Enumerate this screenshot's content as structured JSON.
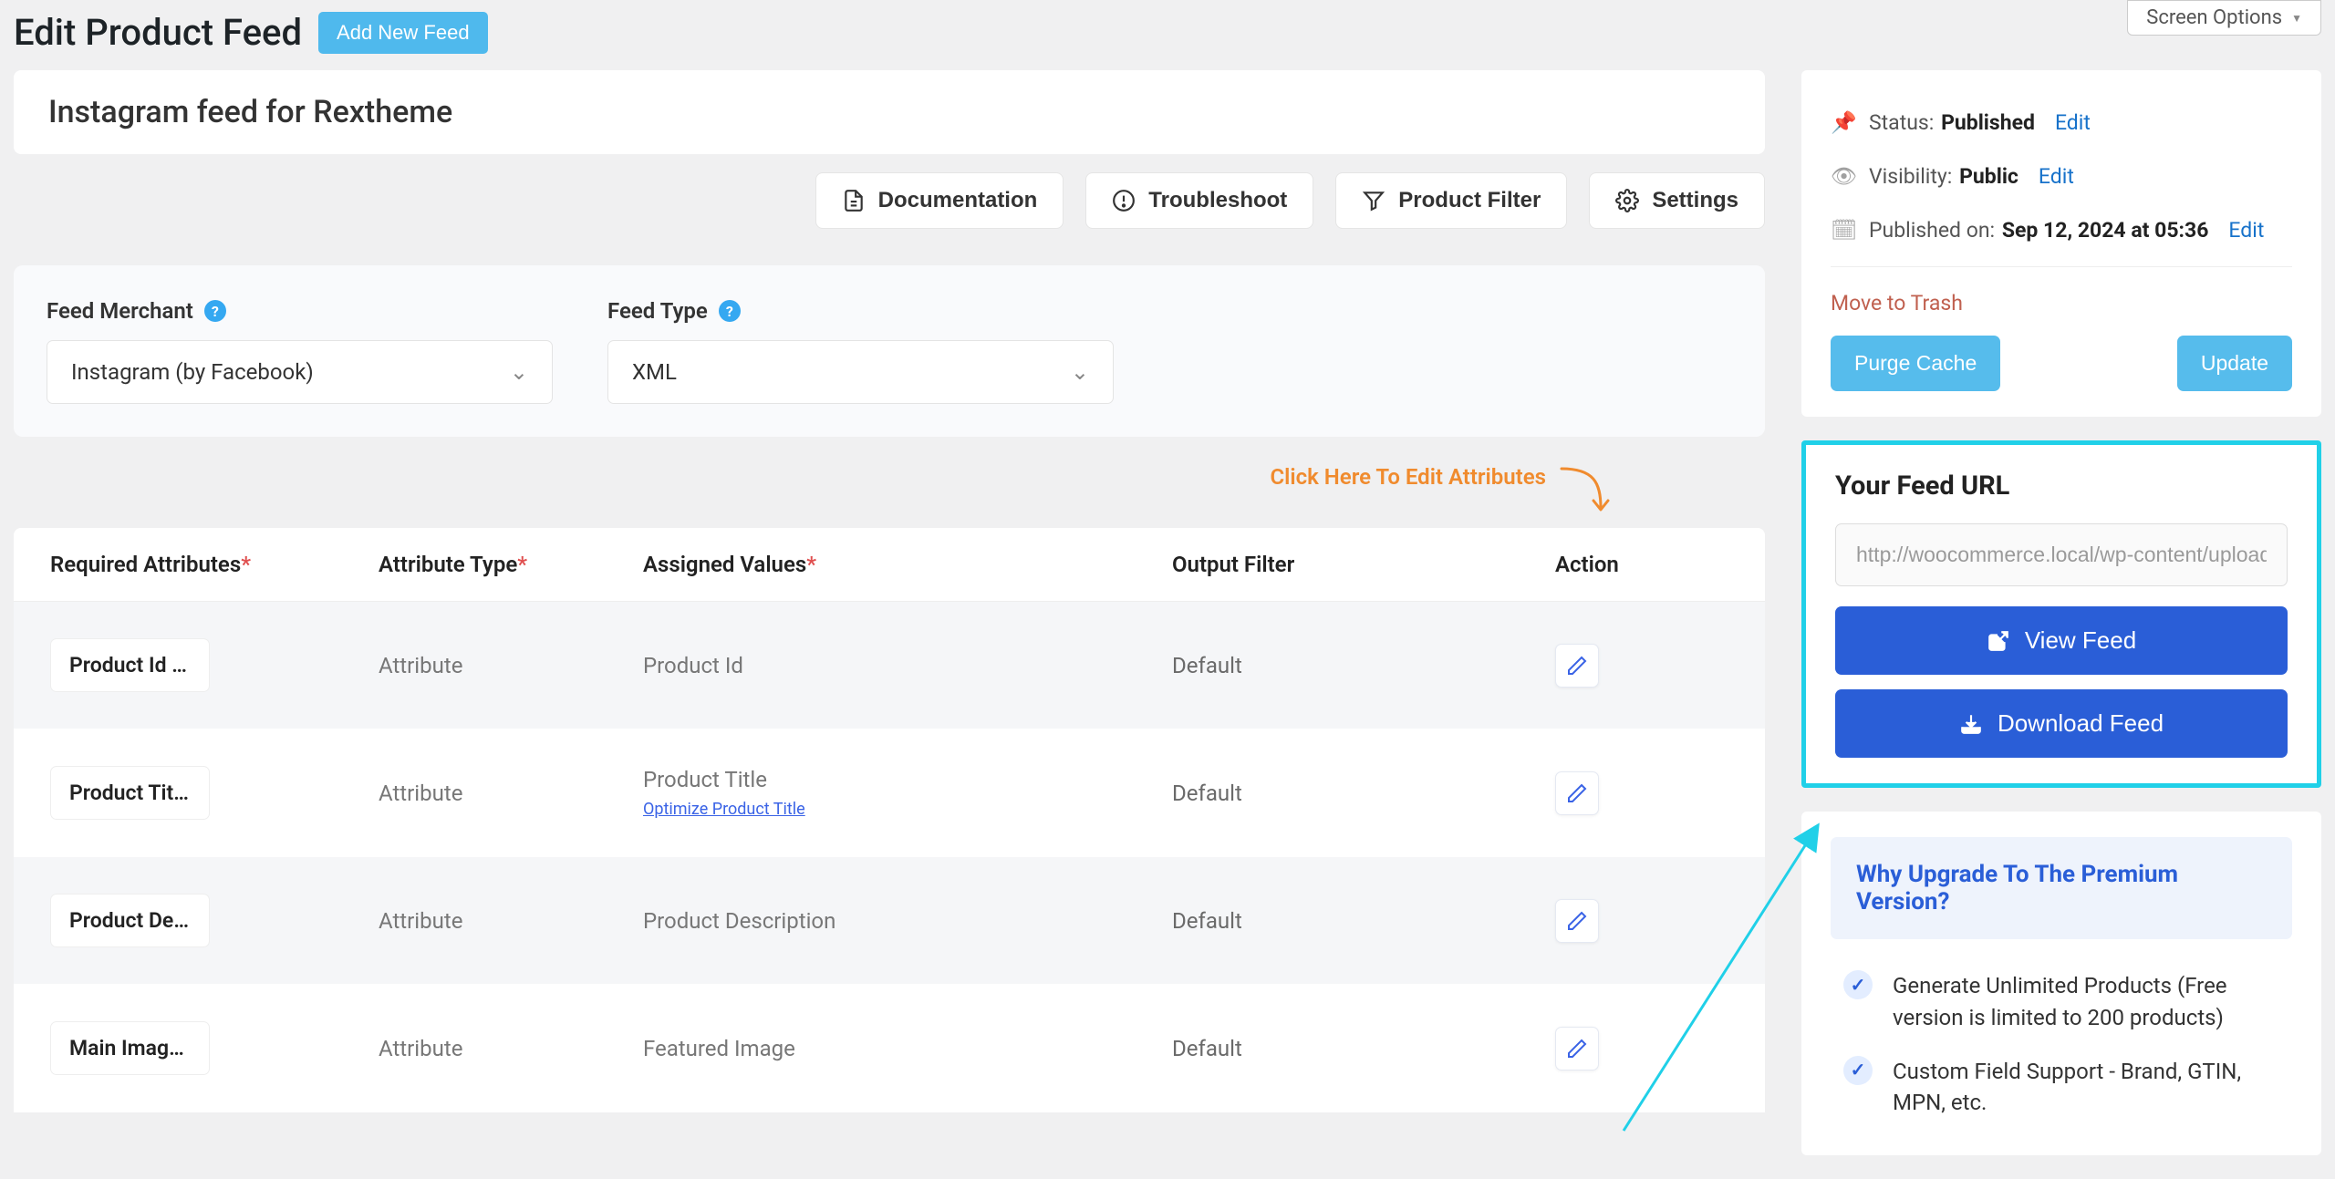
{
  "header": {
    "title": "Edit Product Feed",
    "add_new": "Add New Feed",
    "screen_options": "Screen Options"
  },
  "feed_title": "Instagram feed for Rextheme",
  "action_buttons": {
    "documentation": "Documentation",
    "troubleshoot": "Troubleshoot",
    "product_filter": "Product Filter",
    "settings": "Settings"
  },
  "feed_settings": {
    "merchant_label": "Feed Merchant",
    "merchant_value": "Instagram (by Facebook)",
    "type_label": "Feed Type",
    "type_value": "XML"
  },
  "edit_attr_hint": "Click Here To Edit Attributes",
  "table": {
    "columns": {
      "required": "Required Attributes",
      "attr_type": "Attribute Type",
      "assigned": "Assigned Values",
      "output": "Output Filter",
      "action": "Action"
    },
    "rows": [
      {
        "name": "Product Id [id]",
        "type": "Attribute",
        "assigned": "Product Id",
        "link": "",
        "output": "Default"
      },
      {
        "name": "Product Title …",
        "type": "Attribute",
        "assigned": "Product Title",
        "link": "Optimize Product Title",
        "output": "Default"
      },
      {
        "name": "Product Desc…",
        "type": "Attribute",
        "assigned": "Product Description",
        "link": "",
        "output": "Default"
      },
      {
        "name": "Main Image […",
        "type": "Attribute",
        "assigned": "Featured Image",
        "link": "",
        "output": "Default"
      }
    ]
  },
  "publish": {
    "status_label": "Status:",
    "status_value": "Published",
    "visibility_label": "Visibility:",
    "visibility_value": "Public",
    "published_label": "Published on:",
    "published_value": "Sep 12, 2024 at 05:36",
    "edit": "Edit",
    "trash": "Move to Trash",
    "purge": "Purge Cache",
    "update": "Update"
  },
  "feed_url": {
    "title": "Your Feed URL",
    "url": "http://woocommerce.local/wp-content/uploads",
    "view": "View Feed",
    "download": "Download Feed"
  },
  "upgrade": {
    "title": "Why Upgrade To The Premium Version?",
    "benefits": [
      "Generate Unlimited Products (Free version is limited to 200 products)",
      "Custom Field Support - Brand, GTIN, MPN, etc."
    ]
  }
}
